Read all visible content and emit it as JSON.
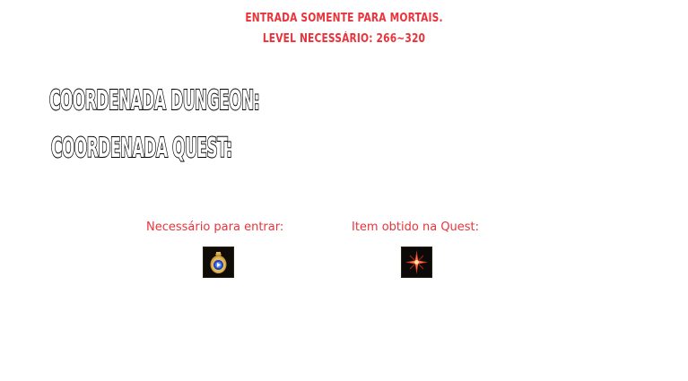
{
  "header": {
    "line1": "ENTRADA SOMENTE PARA MORTAIS.",
    "line2": "LEVEL NECESSÁRIO: 266~320"
  },
  "coordinates": {
    "dungeon_label": "COORDENADA DUNGEON:",
    "dungeon_value": "",
    "quest_label": "COORDENADA QUEST:",
    "quest_value": ""
  },
  "items": {
    "required_caption": "Necessário para entrar:",
    "required_icon": "potion-bag-icon",
    "reward_caption": "Item obtido na Quest:",
    "reward_icon": "red-star-emblem-icon"
  },
  "footer": {
    "note": ""
  },
  "colors": {
    "accent_red": "#e8343a",
    "label_fill": "#ffffff",
    "label_stroke": "#000000",
    "faint_text": "#f4f4f4",
    "faint_footer": "#fbfbe4"
  }
}
